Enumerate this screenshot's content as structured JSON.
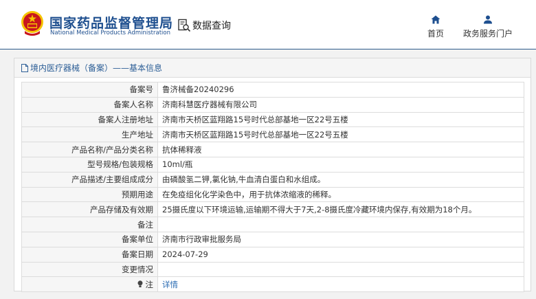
{
  "header": {
    "org_name_cn": "国家药品监督管理局",
    "org_name_en": "National Medical Products Administration",
    "query_label": "数据查询",
    "nav": [
      {
        "label": "首页",
        "icon": "home-icon"
      },
      {
        "label": "政务服务门户",
        "icon": "user-icon"
      }
    ]
  },
  "panel": {
    "title": "境内医疗器械（备案）——基本信息",
    "rows": [
      {
        "label": "备案号",
        "value": "鲁济械备20240296"
      },
      {
        "label": "备案人名称",
        "value": "济南科慧医疗器械有限公司"
      },
      {
        "label": "备案人注册地址",
        "value": "济南市天桥区蓝翔路15号时代总部基地一区22号五楼"
      },
      {
        "label": "生产地址",
        "value": "济南市天桥区蓝翔路15号时代总部基地一区22号五楼"
      },
      {
        "label": "产品名称/产品分类名称",
        "value": "抗体稀释液"
      },
      {
        "label": "型号规格/包装规格",
        "value": "10ml/瓶"
      },
      {
        "label": "产品描述/主要组成成分",
        "value": "由磷酸氢二钾,氯化钠,牛血清白蛋白和水组成。"
      },
      {
        "label": "预期用途",
        "value": "在免疫组化化学染色中，用于抗体浓缩液的稀释。"
      },
      {
        "label": "产品存储及有效期",
        "value": "25摄氏度以下环境运输,运输期不得大于7天,2-8摄氏度冷藏环境内保存,有效期为18个月。"
      },
      {
        "label": "备注",
        "value": ""
      },
      {
        "label": "备案单位",
        "value": "济南市行政审批服务局"
      },
      {
        "label": "备案日期",
        "value": "2024-07-29"
      },
      {
        "label": "变更情况",
        "value": ""
      }
    ],
    "note_label": "注",
    "note_icon": "bulb-icon",
    "detail_link": "详情"
  },
  "colors": {
    "brand_blue": "#1e4f8f",
    "link_blue": "#2b6cb3",
    "emblem_red": "#c8161d",
    "emblem_gold": "#f5c400"
  }
}
